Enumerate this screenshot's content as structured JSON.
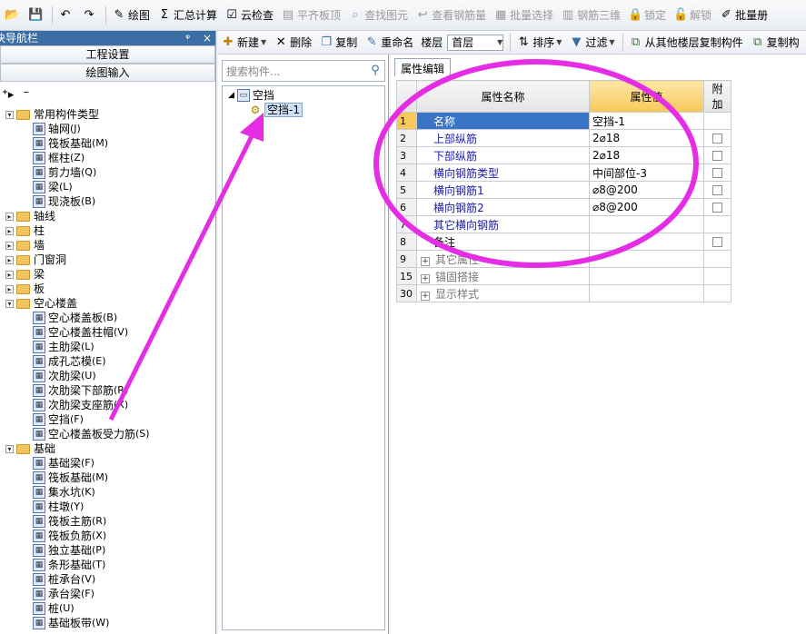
{
  "toolbar": {
    "items": [
      {
        "icon": "open-icon",
        "label": ""
      },
      {
        "icon": "save-icon",
        "label": ""
      },
      {
        "icon": "undo-icon",
        "label": ""
      },
      {
        "icon": "redo-icon",
        "label": ""
      },
      {
        "icon": "draw-icon",
        "label": "绘图"
      },
      {
        "icon": "sum-icon",
        "label": "汇总计算"
      },
      {
        "icon": "cloud-check-icon",
        "label": "云检查"
      },
      {
        "icon": "align-slab-icon",
        "label": "平齐板顶"
      },
      {
        "icon": "find-icon",
        "label": "查找图元"
      },
      {
        "icon": "view-rebar-icon",
        "label": "查看钢筋量"
      },
      {
        "icon": "batch-select-icon",
        "label": "批量选择"
      },
      {
        "icon": "rebar-3d-icon",
        "label": "钢筋三维"
      },
      {
        "icon": "lock-icon",
        "label": "锁定"
      },
      {
        "icon": "unlock-icon",
        "label": "解锁"
      },
      {
        "icon": "batch-icon",
        "label": "批量册"
      }
    ]
  },
  "nav": {
    "title": "块导航栏",
    "pin": "ᵠ",
    "close": "×",
    "btn_settings": "工程设置",
    "btn_draw_input": "绘图输入",
    "tools": [
      "⁺▸",
      "⁻"
    ],
    "tree": [
      {
        "level": 0,
        "type": "folder",
        "exp": "-",
        "label": "常用构件类型"
      },
      {
        "level": 1,
        "type": "leaf",
        "label": "轴网",
        "key": "(J)"
      },
      {
        "level": 1,
        "type": "leaf",
        "label": "筏板基础",
        "key": "(M)"
      },
      {
        "level": 1,
        "type": "leaf",
        "label": "框柱",
        "key": "(Z)"
      },
      {
        "level": 1,
        "type": "leaf",
        "label": "剪力墙",
        "key": "(Q)"
      },
      {
        "level": 1,
        "type": "leaf",
        "label": "梁",
        "key": "(L)"
      },
      {
        "level": 1,
        "type": "leaf",
        "label": "现浇板",
        "key": "(B)"
      },
      {
        "level": 0,
        "type": "folder",
        "exp": "+",
        "label": "轴线"
      },
      {
        "level": 0,
        "type": "folder",
        "exp": "+",
        "label": "柱"
      },
      {
        "level": 0,
        "type": "folder",
        "exp": "+",
        "label": "墙"
      },
      {
        "level": 0,
        "type": "folder",
        "exp": "+",
        "label": "门窗洞"
      },
      {
        "level": 0,
        "type": "folder",
        "exp": "+",
        "label": "梁"
      },
      {
        "level": 0,
        "type": "folder",
        "exp": "+",
        "label": "板"
      },
      {
        "level": 0,
        "type": "folder",
        "exp": "-",
        "label": "空心楼盖"
      },
      {
        "level": 1,
        "type": "leaf",
        "label": "空心楼盖板",
        "key": "(B)"
      },
      {
        "level": 1,
        "type": "leaf",
        "label": "空心楼盖柱帽",
        "key": "(V)"
      },
      {
        "level": 1,
        "type": "leaf",
        "label": "主肋梁",
        "key": "(L)"
      },
      {
        "level": 1,
        "type": "leaf",
        "label": "成孔芯模",
        "key": "(E)"
      },
      {
        "level": 1,
        "type": "leaf",
        "label": "次肋梁",
        "key": "(U)"
      },
      {
        "level": 1,
        "type": "leaf",
        "label": "次肋梁下部筋",
        "key": "(R)"
      },
      {
        "level": 1,
        "type": "leaf",
        "label": "次肋梁支座筋",
        "key": "(X)"
      },
      {
        "level": 1,
        "type": "leaf",
        "label": "空挡",
        "key": "(F)"
      },
      {
        "level": 1,
        "type": "leaf",
        "label": "空心楼盖板受力筋",
        "key": "(S)"
      },
      {
        "level": 0,
        "type": "folder",
        "exp": "-",
        "label": "基础"
      },
      {
        "level": 1,
        "type": "leaf",
        "label": "基础梁",
        "key": "(F)"
      },
      {
        "level": 1,
        "type": "leaf",
        "label": "筏板基础",
        "key": "(M)"
      },
      {
        "level": 1,
        "type": "leaf",
        "label": "集水坑",
        "key": "(K)"
      },
      {
        "level": 1,
        "type": "leaf",
        "label": "柱墩",
        "key": "(Y)"
      },
      {
        "level": 1,
        "type": "leaf",
        "label": "筏板主筋",
        "key": "(R)"
      },
      {
        "level": 1,
        "type": "leaf",
        "label": "筏板负筋",
        "key": "(X)"
      },
      {
        "level": 1,
        "type": "leaf",
        "label": "独立基础",
        "key": "(P)"
      },
      {
        "level": 1,
        "type": "leaf",
        "label": "条形基础",
        "key": "(T)"
      },
      {
        "level": 1,
        "type": "leaf",
        "label": "桩承台",
        "key": "(V)"
      },
      {
        "level": 1,
        "type": "leaf",
        "label": "承台梁",
        "key": "(F)"
      },
      {
        "level": 1,
        "type": "leaf",
        "label": "桩",
        "key": "(U)"
      },
      {
        "level": 1,
        "type": "leaf",
        "label": "基础板带",
        "key": "(W)"
      }
    ]
  },
  "component_toolbar": {
    "new": "新建",
    "delete": "删除",
    "copy": "复制",
    "rename": "重命名",
    "floor_label": "楼层",
    "floor_value": "首层",
    "sort": "排序",
    "filter": "过滤",
    "copy_from_floor": "从其他楼层复制构件",
    "copy_to": "复制构"
  },
  "component_panel": {
    "search_placeholder": "搜索构件...",
    "tree_root": "空挡",
    "tree_child": "空挡-1"
  },
  "property_panel": {
    "tab": "属性编辑",
    "headers": [
      "属性名称",
      "属性值",
      "附加"
    ],
    "rows": [
      {
        "num": "1",
        "name": "名称",
        "value": "空挡-1",
        "check": false,
        "selected": true
      },
      {
        "num": "2",
        "name": "上部纵筋",
        "value": "2⌀18",
        "check": true
      },
      {
        "num": "3",
        "name": "下部纵筋",
        "value": "2⌀18",
        "check": true
      },
      {
        "num": "4",
        "name": "横向钢筋类型",
        "value": "中间部位-3",
        "check": true
      },
      {
        "num": "5",
        "name": "横向钢筋1",
        "value": "⌀8@200",
        "check": true
      },
      {
        "num": "6",
        "name": "横向钢筋2",
        "value": "⌀8@200",
        "check": true
      },
      {
        "num": "7",
        "name": "其它横向钢筋",
        "value": "",
        "check": false
      },
      {
        "num": "8",
        "name": "备注",
        "value": "",
        "check": true,
        "plain": true
      },
      {
        "num": "9",
        "name": "其它属性",
        "value": "",
        "check": false,
        "group": true
      },
      {
        "num": "15",
        "name": "锚固搭接",
        "value": "",
        "check": false,
        "group": true
      },
      {
        "num": "30",
        "name": "显示样式",
        "value": "",
        "check": false,
        "group": true
      }
    ]
  },
  "colors": {
    "annotation": "#e52de5",
    "selection": "#3a74c4",
    "header_highlight": "#f7c85a"
  }
}
